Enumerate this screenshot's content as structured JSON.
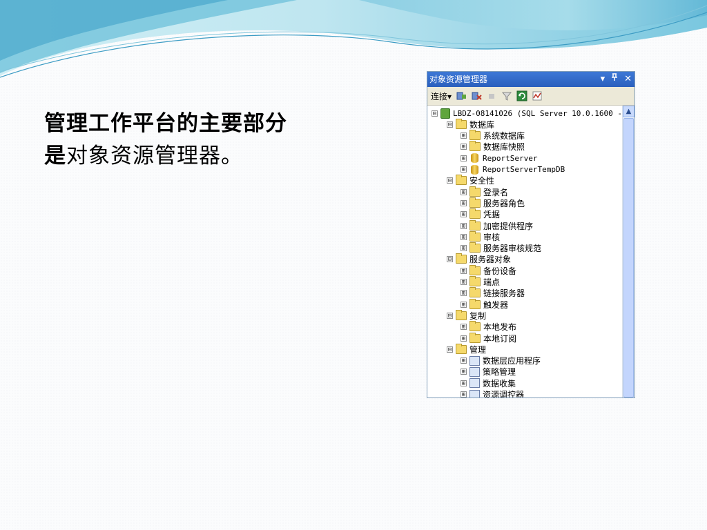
{
  "slide": {
    "line1": "管理工作平台的主要部分",
    "line2_bold": "是",
    "line2_rest": "对象资源管理器。"
  },
  "panel": {
    "title": "对象资源管理器",
    "title_icons": [
      "▾",
      "ᵖ",
      "✕"
    ],
    "toolbar": {
      "connect_label": "连接",
      "connect_dropdown": "▾"
    },
    "tree": [
      {
        "depth": 0,
        "exp": "⊟",
        "icon": "server-icon",
        "text": "LBDZ-08141026 (SQL Server 10.0.1600 -",
        "mono": true
      },
      {
        "depth": 1,
        "exp": "⊟",
        "icon": "folder-icon",
        "text": "数据库"
      },
      {
        "depth": 2,
        "exp": "⊞",
        "icon": "folder-icon",
        "text": "系统数据库"
      },
      {
        "depth": 2,
        "exp": "⊞",
        "icon": "folder-icon",
        "text": "数据库快照"
      },
      {
        "depth": 2,
        "exp": "⊞",
        "icon": "database-icon",
        "text": "ReportServer",
        "mono": true
      },
      {
        "depth": 2,
        "exp": "⊞",
        "icon": "database-icon",
        "text": "ReportServerTempDB",
        "mono": true
      },
      {
        "depth": 1,
        "exp": "⊟",
        "icon": "folder-icon",
        "text": "安全性"
      },
      {
        "depth": 2,
        "exp": "⊞",
        "icon": "folder-icon",
        "text": "登录名"
      },
      {
        "depth": 2,
        "exp": "⊞",
        "icon": "folder-icon",
        "text": "服务器角色"
      },
      {
        "depth": 2,
        "exp": "⊞",
        "icon": "folder-icon",
        "text": "凭据"
      },
      {
        "depth": 2,
        "exp": "⊞",
        "icon": "folder-icon",
        "text": "加密提供程序"
      },
      {
        "depth": 2,
        "exp": "⊞",
        "icon": "folder-icon",
        "text": "审核"
      },
      {
        "depth": 2,
        "exp": "⊞",
        "icon": "folder-icon",
        "text": "服务器审核规范"
      },
      {
        "depth": 1,
        "exp": "⊟",
        "icon": "folder-icon",
        "text": "服务器对象"
      },
      {
        "depth": 2,
        "exp": "⊞",
        "icon": "folder-icon",
        "text": "备份设备"
      },
      {
        "depth": 2,
        "exp": "⊞",
        "icon": "folder-icon",
        "text": "端点"
      },
      {
        "depth": 2,
        "exp": "⊞",
        "icon": "folder-icon",
        "text": "链接服务器"
      },
      {
        "depth": 2,
        "exp": "⊞",
        "icon": "folder-icon",
        "text": "触发器"
      },
      {
        "depth": 1,
        "exp": "⊟",
        "icon": "folder-icon",
        "text": "复制"
      },
      {
        "depth": 2,
        "exp": "⊞",
        "icon": "folder-icon",
        "text": "本地发布"
      },
      {
        "depth": 2,
        "exp": "⊞",
        "icon": "folder-icon",
        "text": "本地订阅"
      },
      {
        "depth": 1,
        "exp": "⊟",
        "icon": "folder-icon",
        "text": "管理"
      },
      {
        "depth": 2,
        "exp": "⊞",
        "icon": "data-tier-app-icon",
        "text": "数据层应用程序"
      },
      {
        "depth": 2,
        "exp": "⊞",
        "icon": "policy-icon",
        "text": "策略管理"
      },
      {
        "depth": 2,
        "exp": "⊞",
        "icon": "data-collection-icon",
        "text": "数据收集"
      },
      {
        "depth": 2,
        "exp": "⊞",
        "icon": "resource-governor-icon",
        "text": "资源调控器"
      }
    ]
  },
  "colors": {
    "titlebar": "#2f66c3",
    "toolbar": "#ece9d8",
    "folder": "#f5d96b",
    "wave_light": "#a9dbe9",
    "wave_dark": "#3f9fc6"
  }
}
